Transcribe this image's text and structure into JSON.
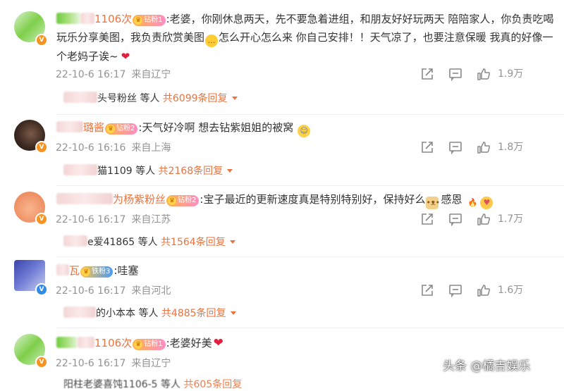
{
  "comments": [
    {
      "username_visible": "1106次",
      "fan_badge": "钻粉1",
      "text_a": ":老婆，你刚休息两天，先不要急着进组，和朋友好好玩两天 陪陪家人，你负责吃喝玩乐分享美图，我负责欣赏美图",
      "text_b": "怎么开心怎么来 你自己安排！！天气凉了，也要注意保暖 我真的好像一个老妈子诶~",
      "date": "22-10-6 16:17",
      "location": "来自辽宁",
      "likes": "1.9万",
      "replies_prefix": "头号粉丝 等人",
      "replies_count": "共6099条回复"
    },
    {
      "username_visible": "璐酱",
      "fan_badge": "钻粉2",
      "text": ":天气好冷啊 想去钻紫姐姐的被窝",
      "date": "22-10-6 16:16",
      "location": "来自上海",
      "likes": "1.8万",
      "replies_prefix": "猫1109 等人",
      "replies_count": "共2168条回复"
    },
    {
      "username_visible": "为杨紫粉丝",
      "fan_badge": "钻粉2",
      "text_a": ":宝子最近的更新速度真是特别特别好，保持好么",
      "text_b": "感恩",
      "date": "22-10-6 16:17",
      "location": "来自江苏",
      "likes": "1.7万",
      "replies_prefix": "e爱41865 等人",
      "replies_count": "共1564条回复"
    },
    {
      "username_visible": "瓦",
      "fan_badge": "铁粉3",
      "text": ":哇塞",
      "date": "22-10-6 16:17",
      "location": "来自河北",
      "likes": "1.6万",
      "replies_prefix": "的小本本 等人",
      "replies_count": "共4885条回复"
    },
    {
      "username_visible": "1106次",
      "fan_badge": "钻粉1",
      "text": ":老婆好美",
      "date": "22-10-6 16:17",
      "location": "来自辽宁",
      "replies_prefix": "阳柱老婆喜饨1106-5 等人",
      "replies_count": "共605条回复"
    }
  ],
  "watermark": "头条 @橘吉娱乐",
  "icons": {
    "repost": "share-icon",
    "comment": "comment-icon",
    "like": "thumbs-up-icon",
    "verified_orange": "orange-v-badge-icon",
    "verified_blue": "blue-v-badge-icon"
  },
  "colors": {
    "accent": "#eb7340",
    "meta": "#939393",
    "text": "#333333"
  }
}
